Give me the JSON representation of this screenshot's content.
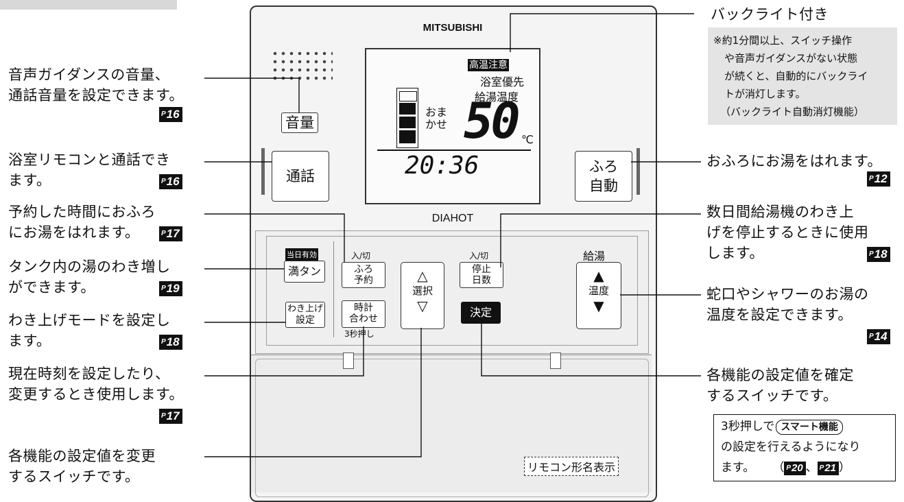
{
  "device": {
    "brand": "MITSUBISHI",
    "model_name": "DIAHOT",
    "model_label": "リモコン形名表示",
    "display": {
      "warning": "高温注意",
      "line1": "浴室優先",
      "line2": "給湯温度",
      "mode_line1": "おま",
      "mode_line2": "かせ",
      "temperature": "50",
      "unit": "℃",
      "clock": "20:36"
    },
    "buttons": {
      "volume": "音量",
      "talk": "通話",
      "auto_bath_l1": "ふろ",
      "auto_bath_l2": "自動",
      "today_valid": "当日有効",
      "full_tank": "満タン",
      "onoff_1": "入/切",
      "bath_reserve_l1": "ふろ",
      "bath_reserve_l2": "予約",
      "boil_setting_l1": "わき上げ",
      "boil_setting_l2": "設定",
      "clock_set_l1": "時計",
      "clock_set_l2": "合わせ",
      "press_3sec": "3秒押し",
      "select": "選択",
      "onoff_2": "入/切",
      "stop_days_l1": "停止",
      "stop_days_l2": "日数",
      "confirm": "決定",
      "hot_water": "給湯",
      "temp": "温度"
    }
  },
  "left_annotations": [
    {
      "line1": "音声ガイダンスの音量、",
      "line2": "通話音量を設定できます。",
      "page": "16"
    },
    {
      "line1": "浴室リモコンと通話でき",
      "line2": "ます。",
      "page": "16"
    },
    {
      "line1": "予約した時間におふろ",
      "line2": "にお湯をはれます。",
      "page": "17"
    },
    {
      "line1": "タンク内の湯のわき増し",
      "line2": "ができます。",
      "page": "19"
    },
    {
      "line1": "わき上げモードを設定し",
      "line2": "ます。",
      "page": "18"
    },
    {
      "line1": "現在時刻を設定したり、",
      "line2": "変更するとき使用します。",
      "page": "17"
    },
    {
      "line1": "各機能の設定値を変更",
      "line2": "するスイッチです。"
    }
  ],
  "right_annotations": {
    "backlight_title": "バックライト付き",
    "backlight_note": [
      "※約1分間以上、スイッチ操作",
      "や音声ガイダンスがない状態",
      "が続くと、自動的にバックライ",
      "トが消灯します。",
      "（バックライト自動消灯機能）"
    ],
    "bath": {
      "line1": "おふろにお湯をはれます。",
      "page": "12"
    },
    "stop": {
      "line1": "数日間給湯機のわき上",
      "line2": "げを停止するときに使用",
      "line3": "します。",
      "page": "18"
    },
    "temp": {
      "line1": "蛇口やシャワーのお湯の",
      "line2": "温度を設定できます。",
      "page": "14"
    },
    "confirm": {
      "line1": "各機能の設定値を確定",
      "line2": "するスイッチです。"
    },
    "smart_box": {
      "pre": "3秒押しで",
      "feature": "スマート機能",
      "line2": "の設定を行えるようになり",
      "line3_pre": "ます。",
      "pages_open": "（",
      "page_a": "20",
      "sep": "、",
      "page_b": "21",
      "pages_close": "）"
    }
  },
  "page_prefix": "P"
}
